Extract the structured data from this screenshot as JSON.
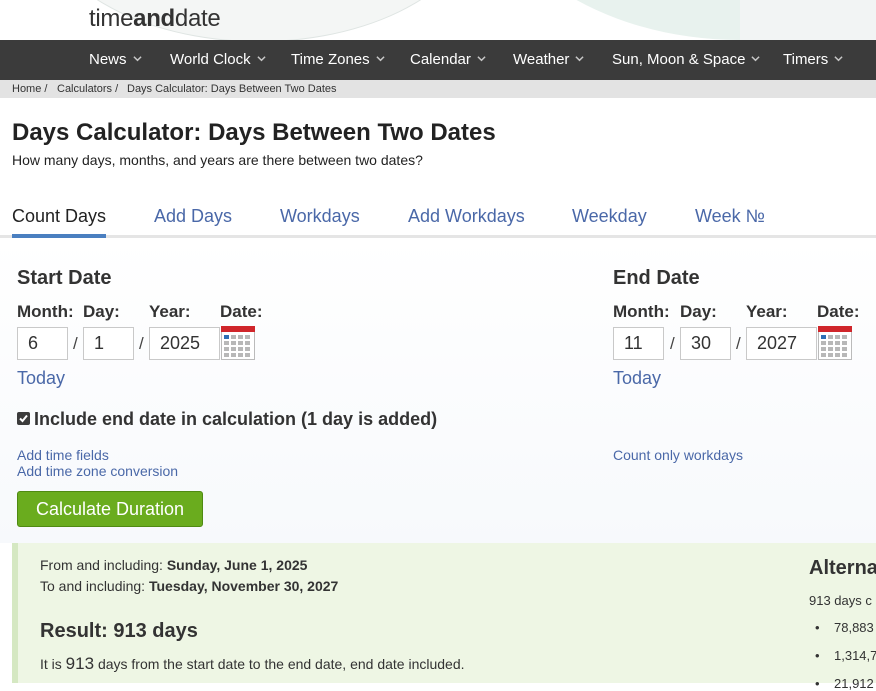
{
  "header": {
    "logo": {
      "part1": "time",
      "part2": "and",
      "part3": "date"
    }
  },
  "nav": {
    "items": [
      {
        "label": "News"
      },
      {
        "label": "World Clock"
      },
      {
        "label": "Time Zones"
      },
      {
        "label": "Calendar"
      },
      {
        "label": "Weather"
      },
      {
        "label": "Sun, Moon & Space"
      },
      {
        "label": "Timers"
      }
    ]
  },
  "breadcrumb": {
    "items": [
      "Home /",
      "Calculators /",
      "Days Calculator: Days Between Two Dates"
    ]
  },
  "page": {
    "title": "Days Calculator: Days Between Two Dates",
    "subtitle": "How many days, months, and years are there between two dates?"
  },
  "tabs": {
    "items": [
      {
        "label": "Count Days",
        "active": true
      },
      {
        "label": "Add Days"
      },
      {
        "label": "Workdays"
      },
      {
        "label": "Add Workdays"
      },
      {
        "label": "Weekday"
      },
      {
        "label": "Week №"
      }
    ]
  },
  "form": {
    "start": {
      "heading": "Start Date",
      "month_label": "Month:",
      "day_label": "Day:",
      "year_label": "Year:",
      "date_label": "Date:",
      "month": "6",
      "day": "1",
      "year": "2025",
      "today": "Today"
    },
    "end": {
      "heading": "End Date",
      "month_label": "Month:",
      "day_label": "Day:",
      "year_label": "Year:",
      "date_label": "Date:",
      "month": "11",
      "day": "30",
      "year": "2027",
      "today": "Today"
    },
    "separator": "/",
    "include_end_label": "Include end date in calculation (1 day is added)",
    "include_end_checked": true,
    "add_time_fields": "Add time fields",
    "add_time_zone": "Add time zone conversion",
    "count_workdays": "Count only workdays",
    "calculate_button": "Calculate Duration"
  },
  "result": {
    "from_label": "From and including:",
    "from_value": "Sunday, June 1, 2025",
    "to_label": "To and including:",
    "to_value": "Tuesday, November 30, 2027",
    "heading": "Result: 913 days",
    "desc_prefix": "It is",
    "desc_number": "913",
    "desc_suffix": "days from the start date to the end date, end date included.",
    "alt_heading": "Alterna",
    "alt_days": "913 days c",
    "alt_items": [
      "78,883",
      "1,314,7",
      "21,912"
    ]
  },
  "colors": {
    "nav_bg": "#3b3b3b",
    "link": "#4a68a8",
    "button": "#6aac1e",
    "result_bg": "#eef6e4"
  }
}
